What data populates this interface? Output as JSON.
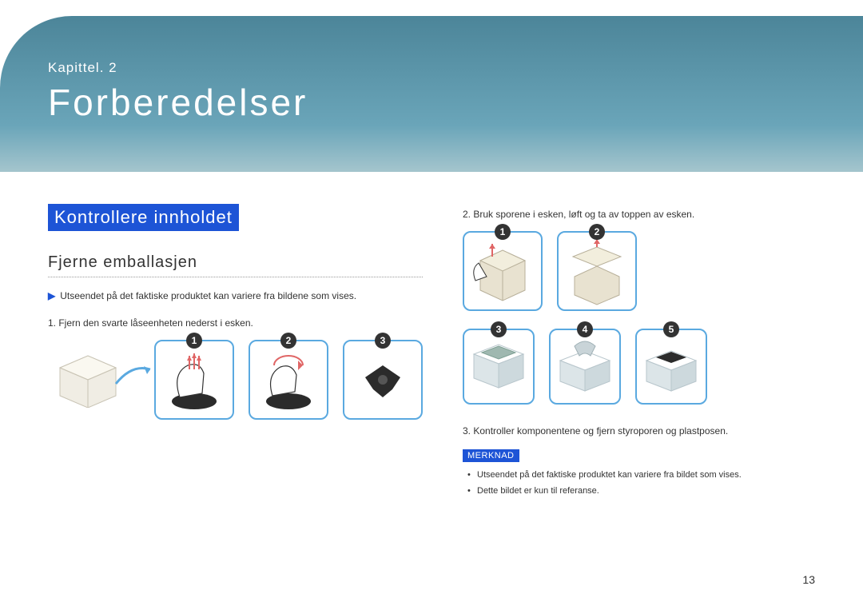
{
  "banner": {
    "chapter_label": "Kapittel. 2",
    "chapter_title": "Forberedelser"
  },
  "section": {
    "heading": "Kontrollere innholdet",
    "sub_heading": "Fjerne emballasjen"
  },
  "left": {
    "note": "Utseendet på det faktiske produktet kan variere fra bildene som vises.",
    "step1": "1. Fjern den svarte låseenheten nederst i esken.",
    "badges": {
      "b1": "1",
      "b2": "2",
      "b3": "3"
    }
  },
  "right": {
    "step2": "2. Bruk sporene i esken, løft og ta av toppen av esken.",
    "step3": "3. Kontroller komponentene og fjern styroporen og plastposen.",
    "badges": {
      "b1": "1",
      "b2": "2",
      "b3": "3",
      "b4": "4",
      "b5": "5"
    },
    "merknad_label": "MERKNAD",
    "merknad_items": [
      "Utseendet på det faktiske produktet kan variere fra bildet som vises.",
      "Dette bildet er kun til referanse."
    ]
  },
  "page_number": "13"
}
